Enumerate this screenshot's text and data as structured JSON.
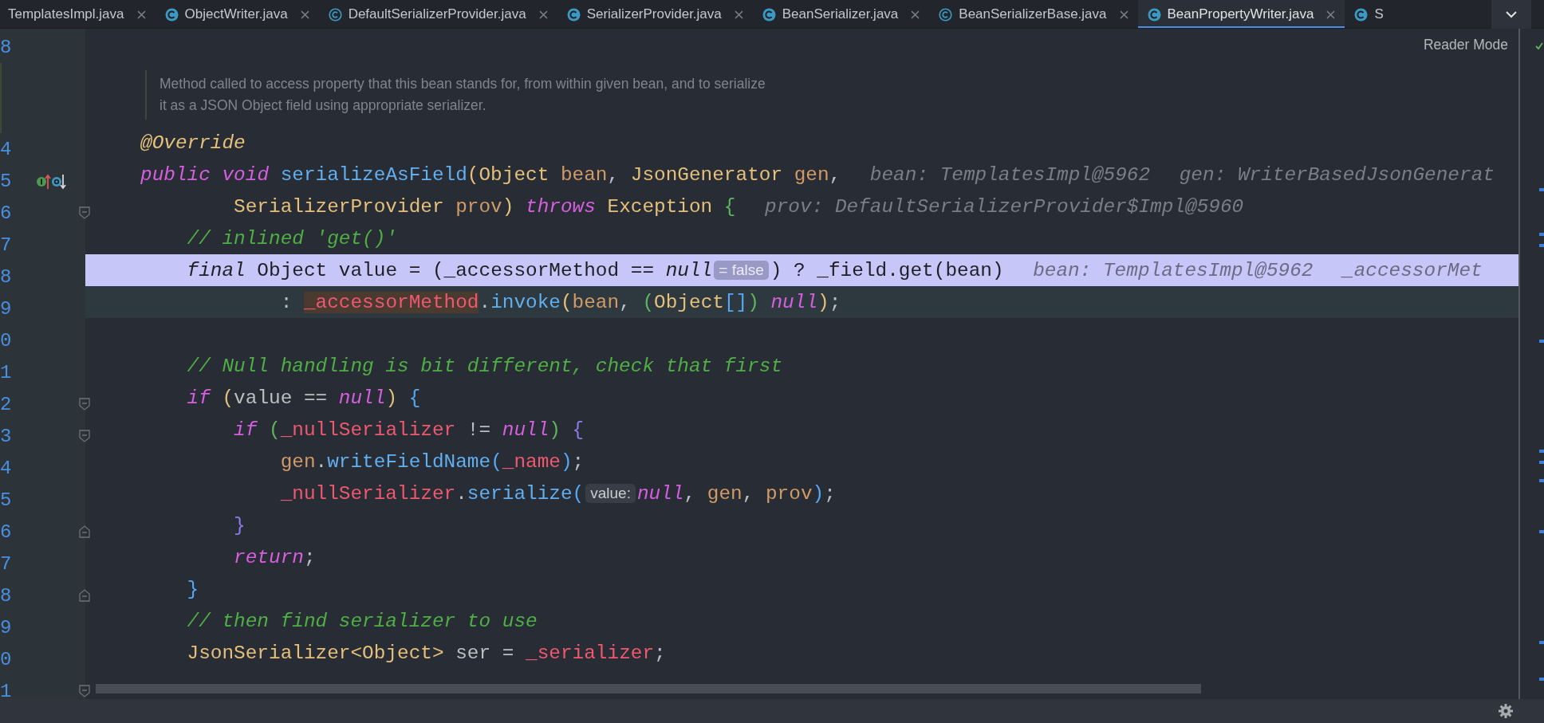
{
  "tabs": [
    {
      "label": "TemplatesImpl.java",
      "kind": "cut",
      "selected": false
    },
    {
      "label": "ObjectWriter.java",
      "kind": "class",
      "selected": false
    },
    {
      "label": "DefaultSerializerProvider.java",
      "kind": "abstract",
      "selected": false
    },
    {
      "label": "SerializerProvider.java",
      "kind": "class",
      "selected": false
    },
    {
      "label": "BeanSerializer.java",
      "kind": "class",
      "selected": false
    },
    {
      "label": "BeanSerializerBase.java",
      "kind": "abstract",
      "selected": false
    },
    {
      "label": "BeanPropertyWriter.java",
      "kind": "class",
      "selected": true
    },
    {
      "label": "S",
      "kind": "partial",
      "selected": false
    }
  ],
  "reader_mode": {
    "label": "Reader Mode"
  },
  "lines": [
    {
      "kind": "code",
      "number": "8",
      "execution": false,
      "caret": false
    },
    {
      "kind": "doc",
      "text_lines": [
        "Method called to access property that this bean stands for, from within given bean, and to serialize",
        "it as a JSON Object field using appropriate serializer."
      ]
    },
    {
      "kind": "code",
      "number": "4",
      "execution": false,
      "caret": false,
      "tokens": [
        {
          "text": "@Override",
          "kind": "anno"
        }
      ]
    },
    {
      "kind": "code",
      "number": "5",
      "execution": false,
      "caret": false,
      "gutter_icons": [
        {
          "kind": "implements"
        },
        {
          "kind": "overridden"
        }
      ],
      "tokens": [
        {
          "text": "public",
          "kind": "kw"
        },
        {
          "text": " void",
          "kind": "kw"
        },
        {
          "text": " serializeAsField",
          "kind": "fn"
        },
        {
          "text": "(",
          "kind": "b1"
        },
        {
          "text": "Object",
          "kind": "type"
        },
        {
          "text": " bean",
          "kind": "param"
        },
        {
          "text": ",",
          "kind": "plain"
        },
        {
          "text": " JsonGenerator",
          "kind": "type"
        },
        {
          "text": " gen",
          "kind": "param"
        },
        {
          "text": ",",
          "kind": "plain"
        },
        {
          "text": "bean: TemplatesImpl@5962",
          "kind": "hint"
        },
        {
          "text": "gen: WriterBasedJsonGenerat",
          "kind": "hint"
        }
      ]
    },
    {
      "kind": "code",
      "number": "6",
      "execution": false,
      "caret": false,
      "fold": {
        "kind": "start"
      },
      "tokens": [
        {
          "text": "        SerializerProvider",
          "kind": "type"
        },
        {
          "text": " prov",
          "kind": "param"
        },
        {
          "text": ")",
          "kind": "b1"
        },
        {
          "text": " throws",
          "kind": "kw"
        },
        {
          "text": " Exception",
          "kind": "type"
        },
        {
          "text": " {",
          "kind": "b2"
        },
        {
          "text": "prov: DefaultSerializerProvider$Impl@5960",
          "kind": "hint"
        }
      ]
    },
    {
      "kind": "code",
      "number": "7",
      "execution": false,
      "caret": false,
      "tokens": [
        {
          "text": "    // inlined 'get()'",
          "kind": "comment"
        }
      ]
    },
    {
      "kind": "code",
      "number": "8",
      "execution": true,
      "caret": false,
      "tokens": [
        {
          "text": "    final",
          "kind": "kw"
        },
        {
          "text": " Object",
          "kind": "type"
        },
        {
          "text": " value = ",
          "kind": "plain"
        },
        {
          "text": "(",
          "kind": "b1"
        },
        {
          "text": "_accessorMethod",
          "kind": "field"
        },
        {
          "text": " == ",
          "kind": "plain"
        },
        {
          "text": "null",
          "kind": "kw"
        },
        {
          "text": "= false",
          "kind": "inlay"
        },
        {
          "text": ")",
          "kind": "b1"
        },
        {
          "text": " ? ",
          "kind": "plain"
        },
        {
          "text": "_field",
          "kind": "field"
        },
        {
          "text": ".",
          "kind": "plain"
        },
        {
          "text": "get",
          "kind": "fn"
        },
        {
          "text": "(",
          "kind": "b2"
        },
        {
          "text": "bean",
          "kind": "param"
        },
        {
          "text": ")",
          "kind": "b2"
        },
        {
          "text": "bean: TemplatesImpl@5962",
          "kind": "hint"
        },
        {
          "text": "_accessorMet",
          "kind": "hint"
        }
      ]
    },
    {
      "kind": "code",
      "number": "9",
      "execution": false,
      "caret": true,
      "tokens": [
        {
          "text": "            : ",
          "kind": "plain"
        },
        {
          "text": "_accessorMethod",
          "kind": "usage"
        },
        {
          "text": ".",
          "kind": "plain"
        },
        {
          "text": "invoke",
          "kind": "fn"
        },
        {
          "text": "(",
          "kind": "b1"
        },
        {
          "text": "bean",
          "kind": "param"
        },
        {
          "text": ", ",
          "kind": "plain"
        },
        {
          "text": "(",
          "kind": "b2"
        },
        {
          "text": "Object",
          "kind": "type"
        },
        {
          "text": "[]",
          "kind": "b3"
        },
        {
          "text": ")",
          "kind": "b2"
        },
        {
          "text": " null",
          "kind": "kw"
        },
        {
          "text": ")",
          "kind": "b1"
        },
        {
          "text": ";",
          "kind": "plain"
        }
      ]
    },
    {
      "kind": "code",
      "number": "0",
      "execution": false,
      "caret": false
    },
    {
      "kind": "code",
      "number": "1",
      "execution": false,
      "caret": false,
      "tokens": [
        {
          "text": "    // Null handling is bit different, check that first",
          "kind": "comment"
        }
      ]
    },
    {
      "kind": "code",
      "number": "2",
      "execution": false,
      "caret": false,
      "fold": {
        "kind": "start"
      },
      "tokens": [
        {
          "text": "    if",
          "kind": "kw"
        },
        {
          "text": " (",
          "kind": "b1"
        },
        {
          "text": "value == ",
          "kind": "plain"
        },
        {
          "text": "null",
          "kind": "kw"
        },
        {
          "text": ")",
          "kind": "b1"
        },
        {
          "text": " {",
          "kind": "b3"
        }
      ]
    },
    {
      "kind": "code",
      "number": "3",
      "execution": false,
      "caret": false,
      "fold": {
        "kind": "start"
      },
      "tokens": [
        {
          "text": "        if",
          "kind": "kw"
        },
        {
          "text": " (",
          "kind": "b2"
        },
        {
          "text": "_nullSerializer",
          "kind": "field"
        },
        {
          "text": " != ",
          "kind": "plain"
        },
        {
          "text": "null",
          "kind": "kw"
        },
        {
          "text": ")",
          "kind": "b2"
        },
        {
          "text": " {",
          "kind": "b4"
        }
      ]
    },
    {
      "kind": "code",
      "number": "4",
      "execution": false,
      "caret": false,
      "tokens": [
        {
          "text": "            gen",
          "kind": "param"
        },
        {
          "text": ".",
          "kind": "plain"
        },
        {
          "text": "writeFieldName",
          "kind": "fn"
        },
        {
          "text": "(",
          "kind": "b3"
        },
        {
          "text": "_name",
          "kind": "field"
        },
        {
          "text": ")",
          "kind": "b3"
        },
        {
          "text": ";",
          "kind": "plain"
        }
      ]
    },
    {
      "kind": "code",
      "number": "5",
      "execution": false,
      "caret": false,
      "tokens": [
        {
          "text": "            _nullSerializer",
          "kind": "field"
        },
        {
          "text": ".",
          "kind": "plain"
        },
        {
          "text": "serialize",
          "kind": "fn"
        },
        {
          "text": "(",
          "kind": "b3"
        },
        {
          "text": "value:",
          "kind": "inlay"
        },
        {
          "text": "null",
          "kind": "kw"
        },
        {
          "text": ", ",
          "kind": "plain"
        },
        {
          "text": "gen",
          "kind": "param"
        },
        {
          "text": ", ",
          "kind": "plain"
        },
        {
          "text": "prov",
          "kind": "param"
        },
        {
          "text": ")",
          "kind": "b3"
        },
        {
          "text": ";",
          "kind": "plain"
        }
      ]
    },
    {
      "kind": "code",
      "number": "6",
      "execution": false,
      "caret": false,
      "fold": {
        "kind": "end"
      },
      "tokens": [
        {
          "text": "        }",
          "kind": "b4"
        }
      ]
    },
    {
      "kind": "code",
      "number": "7",
      "execution": false,
      "caret": false,
      "tokens": [
        {
          "text": "        return",
          "kind": "kw"
        },
        {
          "text": ";",
          "kind": "plain"
        }
      ]
    },
    {
      "kind": "code",
      "number": "8",
      "execution": false,
      "caret": false,
      "fold": {
        "kind": "end"
      },
      "tokens": [
        {
          "text": "    }",
          "kind": "b3"
        }
      ]
    },
    {
      "kind": "code",
      "number": "9",
      "execution": false,
      "caret": false,
      "tokens": [
        {
          "text": "    // then find serializer to use",
          "kind": "comment"
        }
      ]
    },
    {
      "kind": "code",
      "number": "0",
      "execution": false,
      "caret": false,
      "tokens": [
        {
          "text": "    JsonSerializer<Object>",
          "kind": "type"
        },
        {
          "text": " ser = ",
          "kind": "plain"
        },
        {
          "text": "_serializer",
          "kind": "field"
        },
        {
          "text": ";",
          "kind": "plain"
        }
      ]
    },
    {
      "kind": "code",
      "number": "1",
      "execution": false,
      "caret": false,
      "fold": {
        "kind": "start"
      }
    }
  ]
}
